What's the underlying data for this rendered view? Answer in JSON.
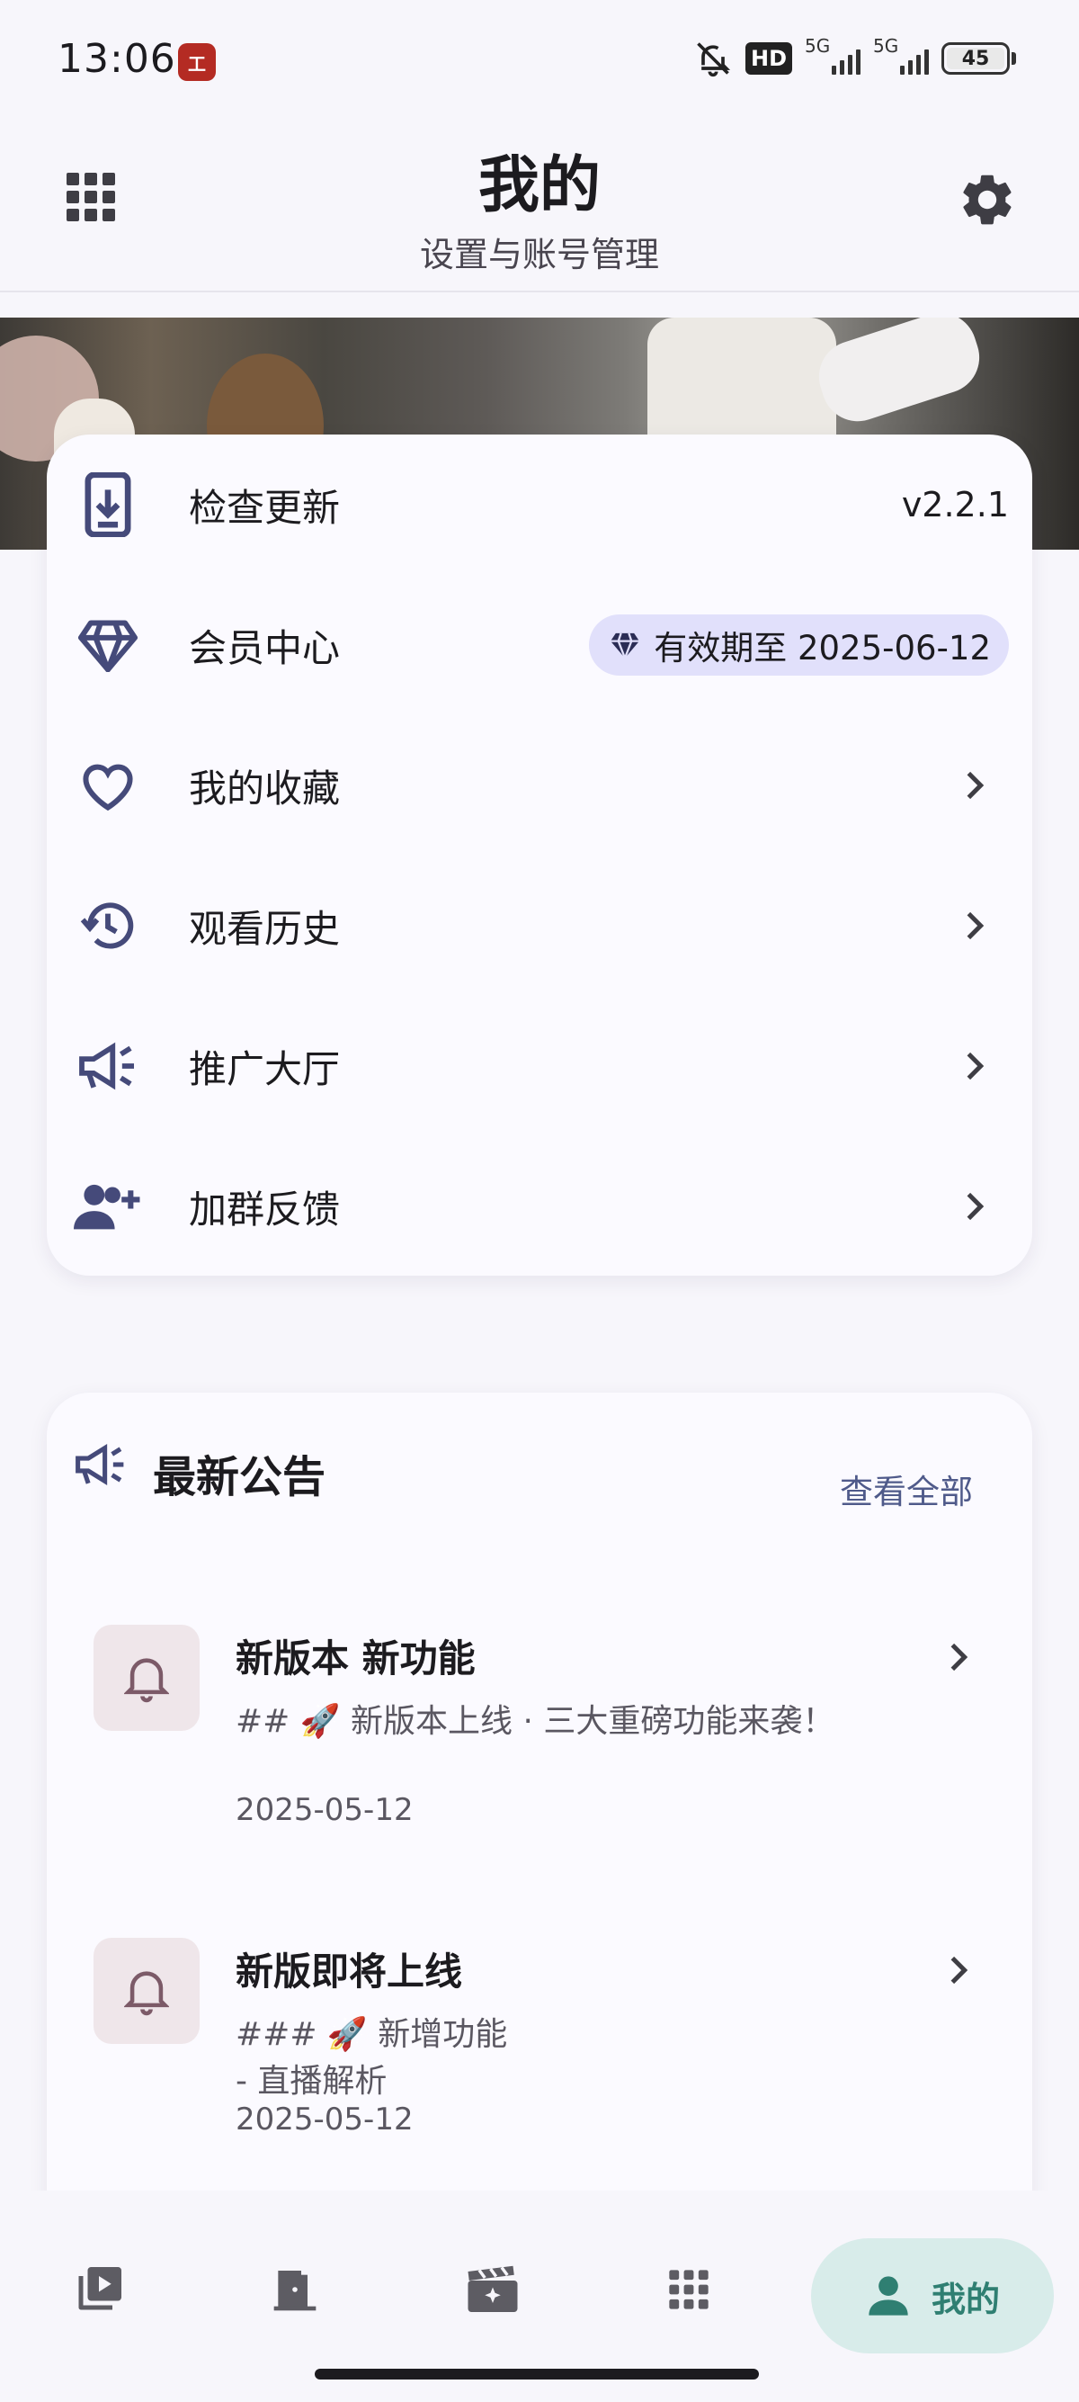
{
  "status_bar": {
    "time": "13:06",
    "app_badge": "工",
    "hd_label": "HD",
    "signal1_tag": "5G",
    "signal2_tag": "5G",
    "battery": "45"
  },
  "header": {
    "title": "我的",
    "subtitle": "设置与账号管理",
    "left_icon": "grid-menu-icon",
    "right_icon": "gear-icon"
  },
  "menu": {
    "items": [
      {
        "icon": "download-phone-icon",
        "label": "检查更新",
        "value": "v2.2.1"
      },
      {
        "icon": "diamond-icon",
        "label": "会员中心",
        "badge": "有效期至 2025-06-12"
      },
      {
        "icon": "heart-icon",
        "label": "我的收藏"
      },
      {
        "icon": "history-icon",
        "label": "观看历史"
      },
      {
        "icon": "megaphone-icon",
        "label": "推广大厅"
      },
      {
        "icon": "add-group-icon",
        "label": "加群反馈"
      }
    ]
  },
  "announcements": {
    "title": "最新公告",
    "view_all": "查看全部",
    "items": [
      {
        "title": "新版本 新功能",
        "line1": "## 🚀 新版本上线 · 三大重磅功能来袭！",
        "date": "2025-05-12"
      },
      {
        "title": "新版即将上线",
        "line1": "### 🚀 新增功能",
        "line2": "- 直播解析",
        "date": "2025-05-12"
      }
    ]
  },
  "bottom_nav": {
    "items": [
      {
        "icon": "video-library-icon"
      },
      {
        "icon": "door-icon"
      },
      {
        "icon": "movie-clapper-icon"
      },
      {
        "icon": "apps-grid-icon"
      }
    ],
    "active_label": "我的",
    "active_icon": "person-icon",
    "accent": "#2f7f72"
  },
  "colors": {
    "icon_tint": "#454a7a",
    "vip_pill": "#e1e0fb",
    "nav_active_bg": "#d8ecea"
  }
}
